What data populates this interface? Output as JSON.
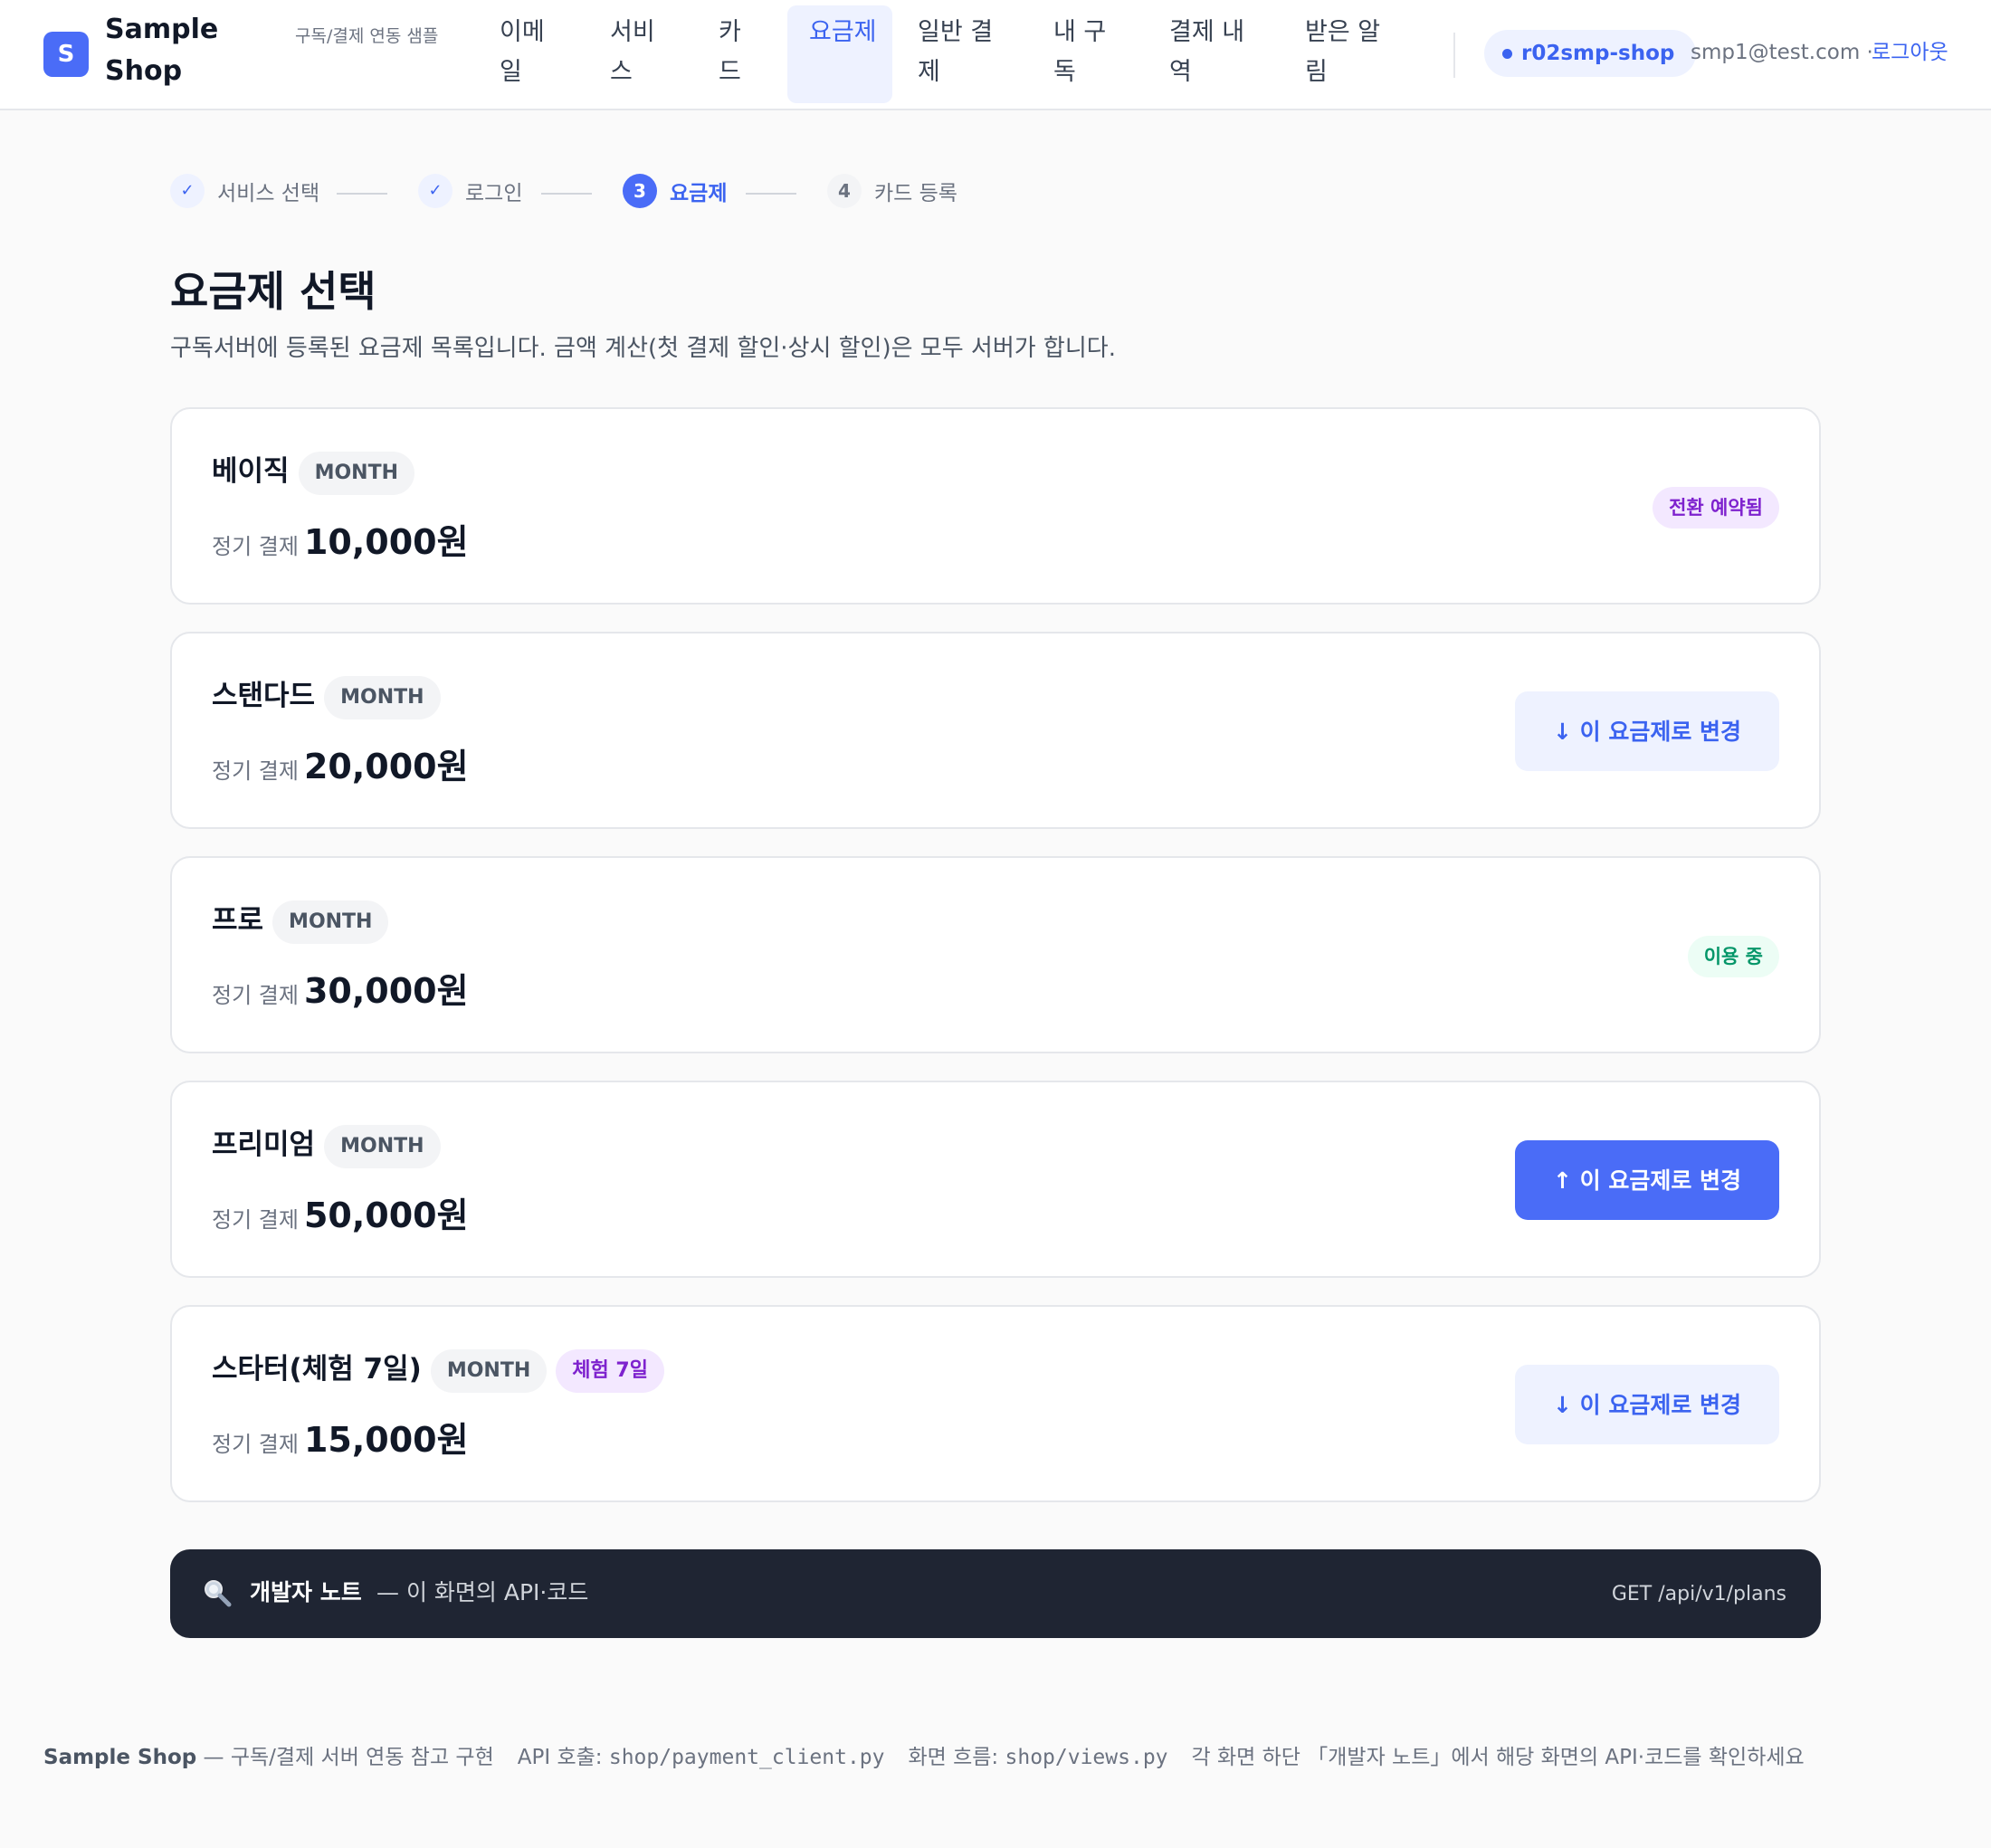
{
  "header": {
    "logo_letter": "S",
    "brand_line1": "Sample",
    "brand_line2": "Shop",
    "brand_sub": "구독/결제 연동 샘플",
    "nav": [
      {
        "label": "이메일",
        "active": false
      },
      {
        "label": "서비스",
        "active": false
      },
      {
        "label": "카드",
        "active": false
      },
      {
        "label": "요금제",
        "active": true
      },
      {
        "label": "일반 결제",
        "active": false
      },
      {
        "label": "내 구독",
        "active": false
      },
      {
        "label": "결제 내역",
        "active": false
      },
      {
        "label": "받은 알림",
        "active": false
      }
    ],
    "shop_id": "r02smp-shop",
    "user_email": "smp1@test.com ·",
    "logout_label": "로그아웃"
  },
  "stepper": [
    {
      "marker": "✓",
      "label": "서비스 선택",
      "state": "done"
    },
    {
      "marker": "✓",
      "label": "로그인",
      "state": "done"
    },
    {
      "marker": "3",
      "label": "요금제",
      "state": "current"
    },
    {
      "marker": "4",
      "label": "카드 등록",
      "state": "pending"
    }
  ],
  "page": {
    "title": "요금제 선택",
    "description": "구독서버에 등록된 요금제 목록입니다. 금액 계산(첫 결제 할인·상시 할인)은 모두 서버가 합니다."
  },
  "plans": [
    {
      "name": "베이직",
      "period": "MONTH",
      "price_label": "정기 결제",
      "price": "10,000원",
      "status": "전환 예약됨"
    },
    {
      "name": "스탠다드",
      "period": "MONTH",
      "price_label": "정기 결제",
      "price": "20,000원",
      "action": "↓ 이 요금제로 변경"
    },
    {
      "name": "프로",
      "period": "MONTH",
      "price_label": "정기 결제",
      "price": "30,000원",
      "status": "이용 중"
    },
    {
      "name": "프리미엄",
      "period": "MONTH",
      "price_label": "정기 결제",
      "price": "50,000원",
      "action": "↑ 이 요금제로 변경"
    },
    {
      "name": "스타터(체험 7일)",
      "period": "MONTH",
      "trial": "체험 7일",
      "price_label": "정기 결제",
      "price": "15,000원",
      "action": "↓ 이 요금제로 변경"
    }
  ],
  "dev_note": {
    "title": "개발자 노트",
    "subtitle": "— 이 화면의 API·코드",
    "endpoint": "GET /api/v1/plans"
  },
  "footer": {
    "brand": "Sample Shop",
    "tagline": " — 구독/결제 서버 연동 참고 구현",
    "api_label": "API 호출: ",
    "api_file": "shop/payment_client.py",
    "flow_label": "화면 흐름: ",
    "flow_file": "shop/views.py",
    "hint": "각 화면 하단 「개발자 노트」에서 해당 화면의 API·코드를 확인하세요"
  },
  "colors": {
    "accent": "#4a6cf7",
    "accent_text": "#3b63f0",
    "status_reserved": "#7e22ce",
    "status_active": "#059669",
    "dev_note_bg": "#1f2533"
  },
  "icons": {
    "logo": "letter-s-logo",
    "dev_note": "magnifier-icon",
    "step_done": "check-icon"
  }
}
